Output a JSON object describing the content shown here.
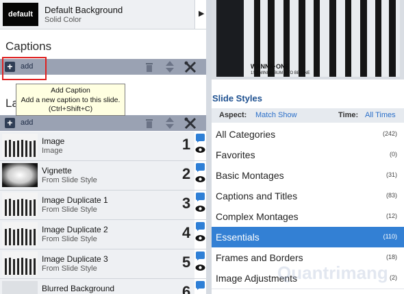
{
  "background": {
    "thumb_label": "default",
    "title": "Default Background",
    "subtitle": "Solid Color"
  },
  "captions": {
    "title": "Captions",
    "add_label": "add"
  },
  "tooltip": {
    "line1": "Add Caption",
    "line2": "Add a new caption to this slide.",
    "line3": "(Ctrl+Shift+C)"
  },
  "layers": {
    "title_partial": "La",
    "add_label": "add",
    "items": [
      {
        "name": "Image",
        "sub": "Image",
        "num": "1"
      },
      {
        "name": "Vignette",
        "sub": "From Slide Style",
        "num": "2"
      },
      {
        "name": "Image Duplicate 1",
        "sub": "From Slide Style",
        "num": "3"
      },
      {
        "name": "Image Duplicate 2",
        "sub": "From Slide Style",
        "num": "4"
      },
      {
        "name": "Image Duplicate 3",
        "sub": "From Slide Style",
        "num": "5"
      },
      {
        "name": "Blurred Background",
        "sub": "",
        "num": "6"
      }
    ]
  },
  "preview": {
    "caption_line1": "WANNA·ONE",
    "caption_line2": "1ST MINI ALBUM × TO BE ONE"
  },
  "slide_styles": {
    "title": "Slide Styles",
    "aspect_label": "Aspect:",
    "aspect_value": "Match Show",
    "time_label": "Time:",
    "time_value": "All Times",
    "selected_color": "#3380d4",
    "categories": [
      {
        "label": "All Categories",
        "count": "(242)"
      },
      {
        "label": "Favorites",
        "count": "(0)"
      },
      {
        "label": "Basic Montages",
        "count": "(31)"
      },
      {
        "label": "Captions and Titles",
        "count": "(83)"
      },
      {
        "label": "Complex Montages",
        "count": "(12)"
      },
      {
        "label": "Essentials",
        "count": "(110)",
        "selected": true
      },
      {
        "label": "Frames and Borders",
        "count": "(18)"
      },
      {
        "label": "Image Adjustments",
        "count": "(2)"
      }
    ]
  },
  "watermark": "Quantrimang"
}
